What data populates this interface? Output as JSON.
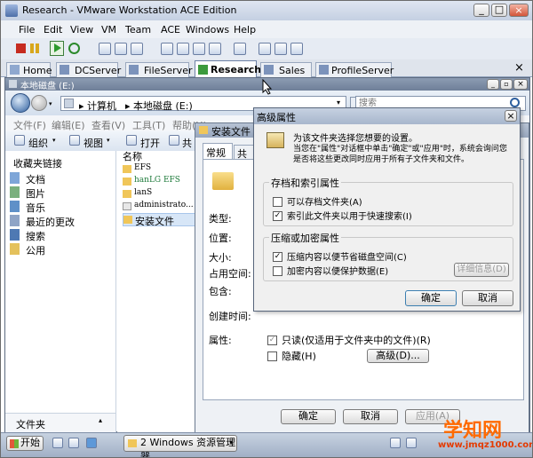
{
  "app": {
    "title": "Research - VMware Workstation ACE Edition",
    "min": "_",
    "max": "□",
    "close": "×"
  },
  "menu": [
    "File",
    "Edit",
    "View",
    "VM",
    "Team",
    "ACE",
    "Windows",
    "Help"
  ],
  "tabs": [
    {
      "label": "Home",
      "active": false
    },
    {
      "label": "DCServer",
      "active": false
    },
    {
      "label": "FileServer",
      "active": false
    },
    {
      "label": "Research",
      "active": true
    },
    {
      "label": "Sales",
      "active": false
    },
    {
      "label": "ProfileServer",
      "active": false
    }
  ],
  "explorer": {
    "title": "本地磁盘 (E:)",
    "address": [
      "▸ 计算机",
      "▸ 本地磁盘 (E:)"
    ],
    "search_placeholder": "搜索",
    "menu": [
      "文件(F)",
      "编辑(E)",
      "查看(V)",
      "工具(T)",
      "帮助(H)"
    ],
    "toolbar": {
      "organize": "组织",
      "views": "视图",
      "open": "打开",
      "share": "共"
    },
    "favorites_header": "收藏夹链接",
    "favorites": [
      "文档",
      "图片",
      "音乐",
      "最近的更改",
      "搜索",
      "公用"
    ],
    "folders_label": "文件夹",
    "column_name": "名称",
    "files": [
      "EFS",
      "hanLG EFS",
      "lanS",
      "administrato...",
      "安装文件"
    ]
  },
  "props": {
    "title": "安装文件 属",
    "tabs": [
      "常规",
      "共享"
    ],
    "fields": [
      "类型:",
      "位置:",
      "大小:",
      "占用空间:",
      "包含:",
      "创建时间:",
      "属性:"
    ],
    "readonly_label": "只读(仅适用于文件夹中的文件)(R)",
    "hidden_label": "隐藏(H)",
    "advanced_btn": "高级(D)...",
    "ok": "确定",
    "cancel": "取消",
    "apply": "应用(A)"
  },
  "adv": {
    "title": "高级属性",
    "desc1": "为该文件夹选择您想要的设置。",
    "desc2": "当您在\"属性\"对话框中单击\"确定\"或\"应用\"时，系统会询问您是否将这些更改同时应用于所有子文件夹和文件。",
    "group1": "存档和索引属性",
    "archive": "可以存档文件夹(A)",
    "index": "索引此文件夹以用于快速搜索(I)",
    "group2": "压缩或加密属性",
    "compress": "压缩内容以便节省磁盘空间(C)",
    "encrypt": "加密内容以便保护数据(E)",
    "details": "详细信息(D)",
    "ok": "确定",
    "cancel": "取消",
    "close": "×"
  },
  "taskbar": {
    "start": "开始",
    "window": "2 Windows 资源管理器",
    "arrow": "▾"
  },
  "watermark": {
    "line1": "学知网",
    "line2": "www.jmqz1000.com"
  }
}
